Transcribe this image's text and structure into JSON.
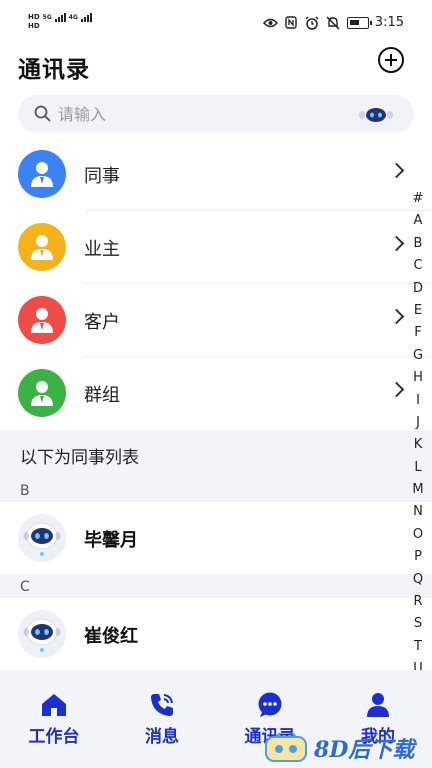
{
  "status_bar": {
    "net_top": "HD",
    "net_bottom": "HD",
    "sig1": "5G",
    "sig2": "4G",
    "time": "3:15"
  },
  "header": {
    "title": "通讯录"
  },
  "search": {
    "placeholder": "请输入"
  },
  "groups": [
    {
      "label": "同事",
      "color": "#3b82f6"
    },
    {
      "label": "业主",
      "color": "#f5b31b"
    },
    {
      "label": "客户",
      "color": "#ef4b47"
    },
    {
      "label": "群组",
      "color": "#3bb244"
    }
  ],
  "section_caption": "以下为同事列表",
  "contacts": [
    {
      "letter": "B",
      "name": "毕馨月"
    },
    {
      "letter": "C",
      "name": "崔俊红"
    }
  ],
  "alphabet": [
    "#",
    "A",
    "B",
    "C",
    "D",
    "E",
    "F",
    "G",
    "H",
    "I",
    "J",
    "K",
    "L",
    "M",
    "N",
    "O",
    "P",
    "Q",
    "R",
    "S",
    "T",
    "U"
  ],
  "tabs": [
    {
      "label": "工作台",
      "icon": "home-icon"
    },
    {
      "label": "消息",
      "icon": "phone-icon"
    },
    {
      "label": "通讯录",
      "icon": "chat-bubble-icon"
    },
    {
      "label": "我的",
      "icon": "person-icon"
    }
  ],
  "watermark": {
    "text": "8D后下载"
  },
  "colors": {
    "accent": "#1a2fd0",
    "band": "#f3f4f7"
  }
}
